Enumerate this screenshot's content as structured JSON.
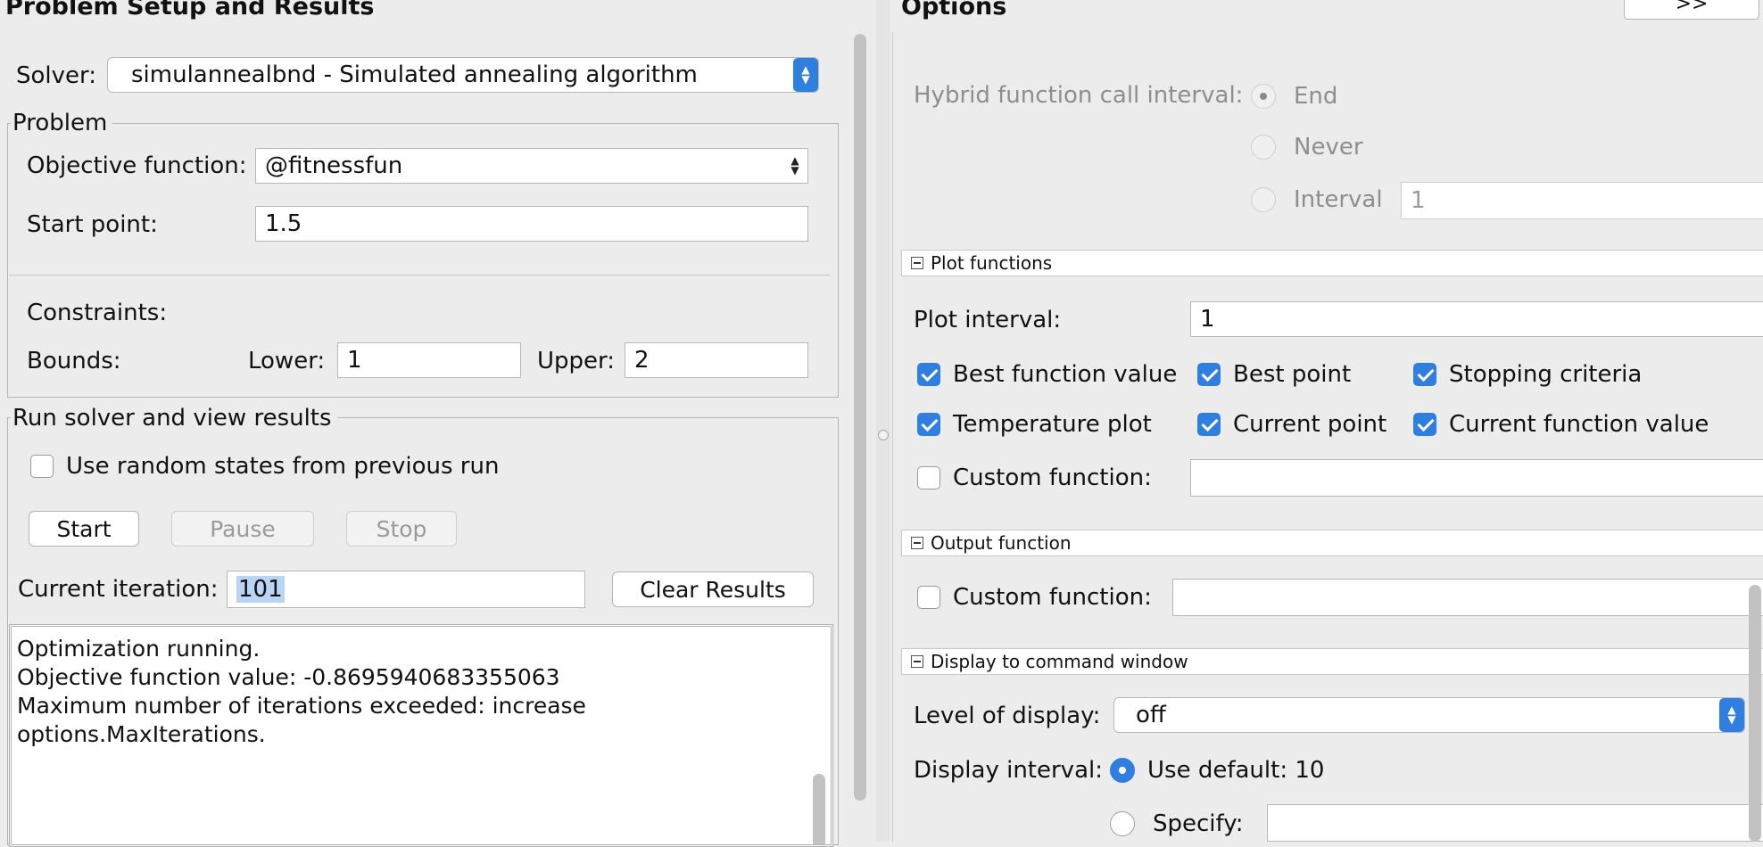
{
  "left": {
    "header": "Problem Setup and Results",
    "solver": {
      "label": "Solver:",
      "value": "simulannealbnd - Simulated annealing algorithm"
    },
    "problem": {
      "title": "Problem",
      "objective_label": "Objective function:",
      "objective_value": "@fitnessfun",
      "start_label": "Start point:",
      "start_value": "1.5",
      "constraints_label": "Constraints:",
      "bounds_label": "Bounds:",
      "lower_label": "Lower:",
      "lower_value": "1",
      "upper_label": "Upper:",
      "upper_value": "2"
    },
    "run": {
      "title": "Run solver and view results",
      "random_states_label": "Use random states from previous run",
      "start_button": "Start",
      "pause_button": "Pause",
      "stop_button": "Stop",
      "iteration_label": "Current iteration:",
      "iteration_value": "101",
      "clear_button": "Clear Results",
      "output_lines": [
        "Optimization running.",
        "Objective function value: -0.8695940683355063",
        "Maximum number of iterations exceeded: increase",
        "options.MaxIterations."
      ]
    }
  },
  "right": {
    "header": "Options",
    "expand_button": ">>",
    "hybrid": {
      "label": "Hybrid function call interval:",
      "end_label": "End",
      "never_label": "Never",
      "interval_label": "Interval",
      "interval_value": "1"
    },
    "plot": {
      "section_title": "Plot functions",
      "interval_label": "Plot interval:",
      "interval_value": "1",
      "best_function_value": "Best function value",
      "best_point": "Best point",
      "stopping_criteria": "Stopping criteria",
      "temperature_plot": "Temperature plot",
      "current_point": "Current point",
      "current_function_value": "Current function value",
      "custom_function": "Custom function:"
    },
    "output": {
      "section_title": "Output function",
      "custom_function": "Custom function:"
    },
    "display": {
      "section_title": "Display to command window",
      "level_label": "Level of display:",
      "level_value": "off",
      "interval_label": "Display interval:",
      "use_default_label": "Use default: 10",
      "specify_label": "Specify:"
    }
  },
  "colors": {
    "accent": "#2f7fe0",
    "background": "#ececec",
    "selection": "#b9d4f5"
  }
}
